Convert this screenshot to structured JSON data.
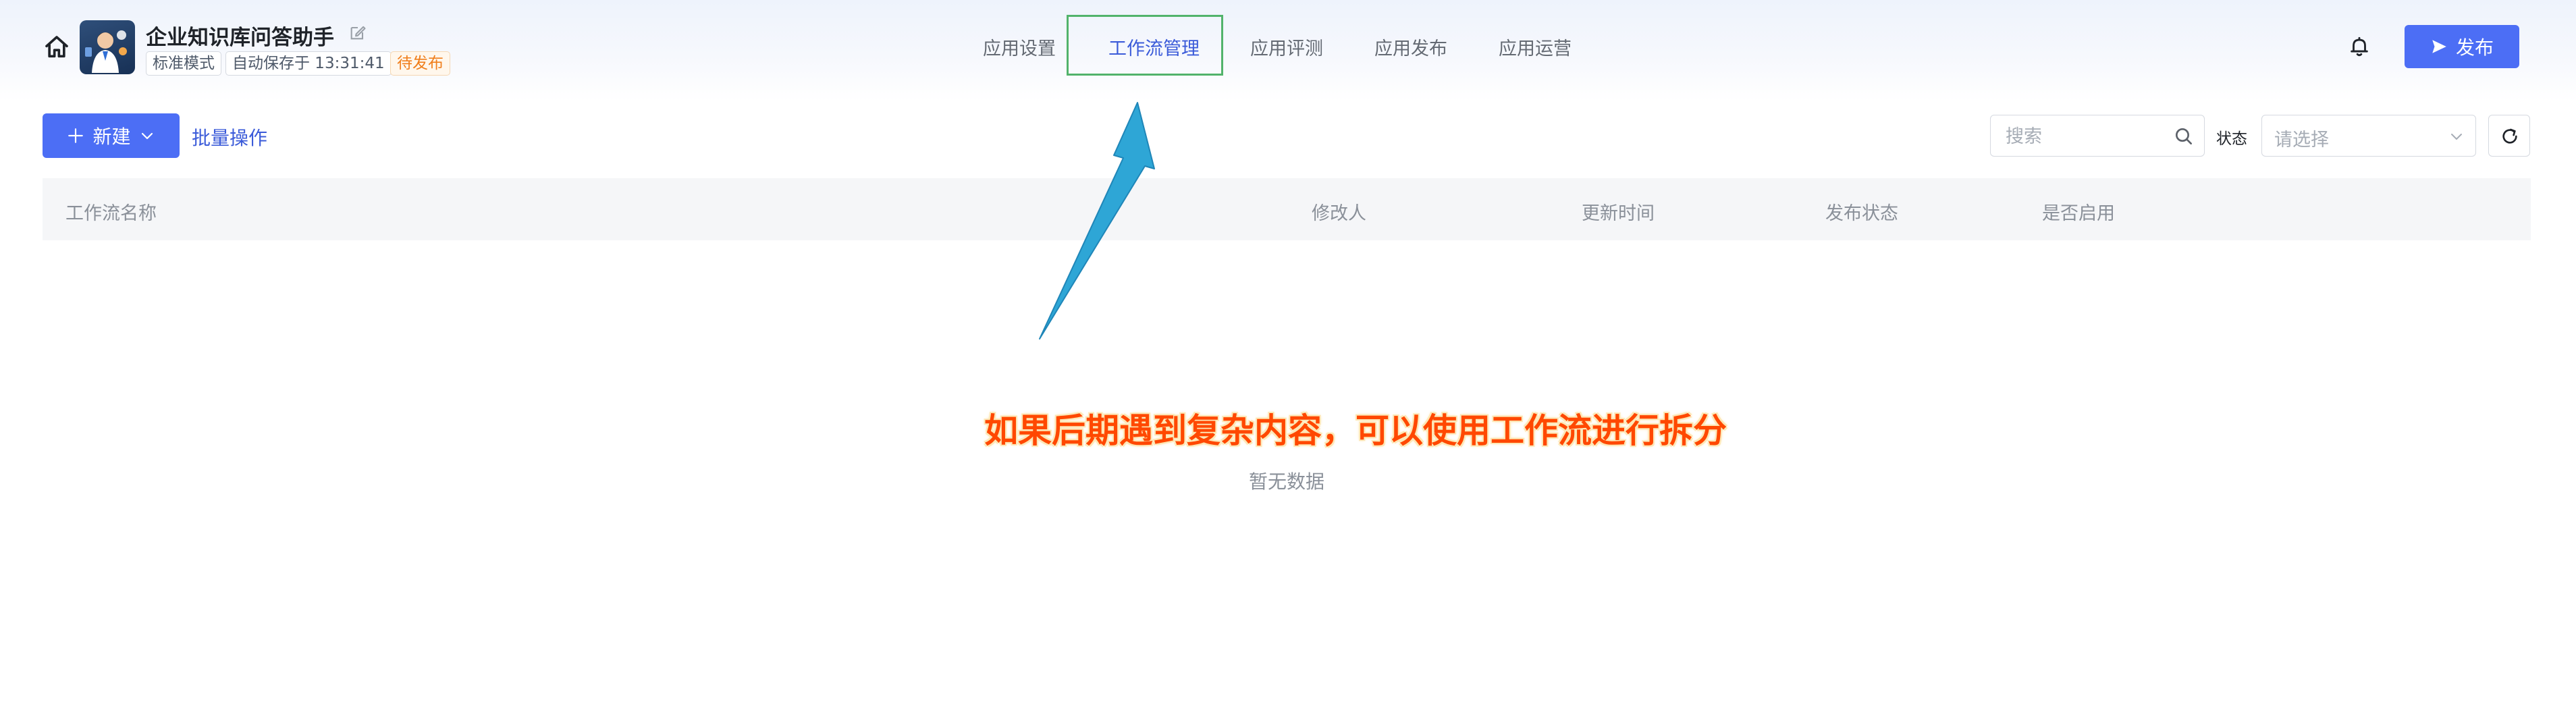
{
  "app": {
    "title": "企业知识库问答助手",
    "mode_tag": "标准模式",
    "autosave_tag": "自动保存于 13:31:41",
    "status_tag": "待发布"
  },
  "nav": {
    "tabs": [
      {
        "label": "应用设置",
        "active": false
      },
      {
        "label": "工作流管理",
        "active": true
      },
      {
        "label": "应用评测",
        "active": false
      },
      {
        "label": "应用发布",
        "active": false
      },
      {
        "label": "应用运营",
        "active": false
      }
    ]
  },
  "header_actions": {
    "publish_label": "发布"
  },
  "toolbar": {
    "new_label": "新建",
    "batch_label": "批量操作",
    "search_placeholder": "搜索",
    "status_label": "状态",
    "status_placeholder": "请选择"
  },
  "table": {
    "columns": [
      "工作流名称",
      "修改人",
      "更新时间",
      "发布状态",
      "是否启用"
    ],
    "rows": [],
    "empty_text": "暂无数据"
  },
  "annotation": {
    "text": "如果后期遇到复杂内容，可以使用工作流进行拆分"
  },
  "colors": {
    "primary": "#4c6ef5",
    "active_tab": "#3b5bd9",
    "status_pending": "#f07e1b",
    "highlight_box": "#52b36b",
    "annotation_text": "#ff4800",
    "arrow": "#2ea6d6"
  }
}
